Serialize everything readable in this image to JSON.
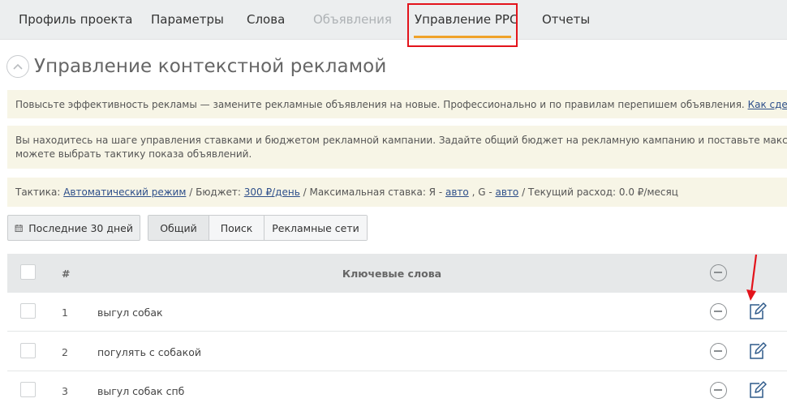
{
  "nav": {
    "tabs": [
      {
        "label": "Профиль проекта"
      },
      {
        "label": "Параметры"
      },
      {
        "label": "Слова"
      },
      {
        "label": "Объявления"
      },
      {
        "label": "Управление PPC"
      },
      {
        "label": "Отчеты"
      }
    ]
  },
  "page": {
    "title": "Управление контекстной рекламой"
  },
  "notices": {
    "improve_text": "Повысьте эффективность рекламы — замените рекламные объявления на новые. Профессионально и по правилам перепишем объявления.",
    "improve_link": "Как сделать зака",
    "step_text_1": "Вы находитесь на шаге управления ставками и бюджетом рекламной кампании. Задайте общий бюджет на рекламную кампанию и поставьте максимальные",
    "step_text_2": "можете выбрать тактику показа объявлений."
  },
  "tactic": {
    "label_tactic": "Тактика:",
    "tactic_value": "Автоматический режим",
    "label_budget": "/ Бюджет:",
    "budget_value": "300 ₽/день",
    "label_max_bid": "/ Максимальная ставка: Я -",
    "yandex_value": "авто",
    "label_google": ", G -",
    "google_value": "авто",
    "label_spend": "/ Текущий расход: 0.0 ₽/месяц"
  },
  "filters": {
    "date_label": "Последние 30 дней",
    "segments": [
      {
        "label": "Общий"
      },
      {
        "label": "Поиск"
      },
      {
        "label": "Рекламные сети"
      }
    ]
  },
  "table": {
    "columns": {
      "num": "#",
      "keywords": "Ключевые слова"
    },
    "rows": [
      {
        "num": "1",
        "keyword": "выгул собак"
      },
      {
        "num": "2",
        "keyword": "погулять с собакой"
      },
      {
        "num": "3",
        "keyword": "выгул собак спб"
      }
    ]
  },
  "colors": {
    "highlight_border": "#e3131b",
    "active_underline": "#f0a22a",
    "link": "#2e4f8a",
    "notice_bg": "#f7f5e6"
  }
}
